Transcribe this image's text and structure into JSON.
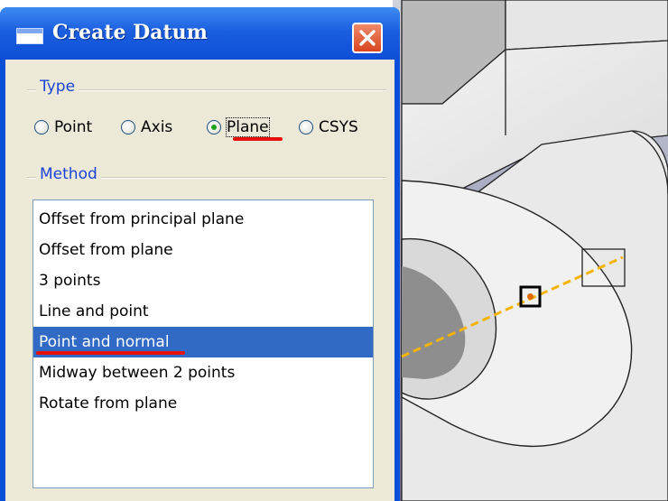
{
  "dialog": {
    "title": "Create Datum",
    "close_icon": "close-icon"
  },
  "type_group": {
    "label": "Type",
    "options": [
      {
        "label": "Point",
        "selected": false
      },
      {
        "label": "Axis",
        "selected": false
      },
      {
        "label": "Plane",
        "selected": true
      },
      {
        "label": "CSYS",
        "selected": false
      }
    ]
  },
  "method_group": {
    "label": "Method",
    "items": [
      {
        "label": "Offset from principal plane",
        "selected": false
      },
      {
        "label": "Offset from plane",
        "selected": false
      },
      {
        "label": "3 points",
        "selected": false
      },
      {
        "label": "Line and point",
        "selected": false
      },
      {
        "label": "Point and normal",
        "selected": true
      },
      {
        "label": "Midway between 2 points",
        "selected": false
      },
      {
        "label": "Rotate from plane",
        "selected": false
      }
    ]
  },
  "colors": {
    "title_bar": "#0d4ed6",
    "selection": "#316ac5",
    "group_label": "#1a44d8",
    "annotation_underline": "#e8110a",
    "normal_axis": "#f5b400"
  }
}
